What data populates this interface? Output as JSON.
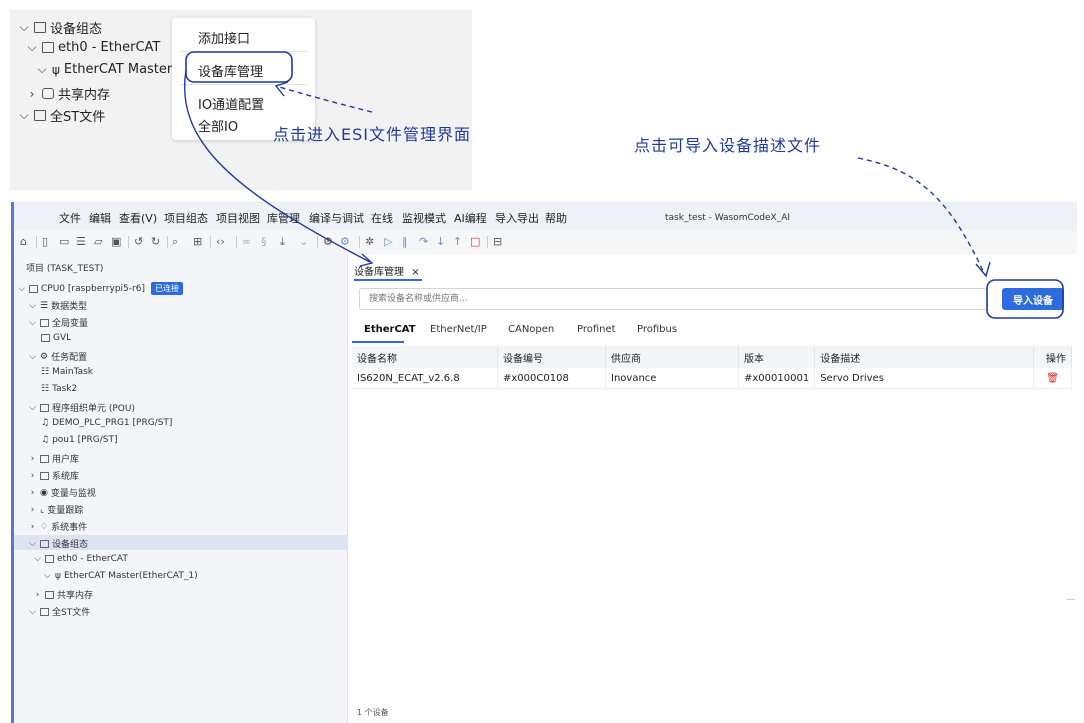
{
  "zoom": {
    "tree": [
      "设备组态",
      "eth0 - EtherCAT",
      "EtherCAT Master(",
      "共享内存",
      "全ST文件"
    ],
    "menu": [
      "添加接口",
      "设备库管理",
      "IO通道配置",
      "全部IO"
    ]
  },
  "annotations": {
    "esi": "点击进入ESI文件管理界面",
    "import": "点击可导入设备描述文件"
  },
  "window": {
    "title": "task_test - WasomCodeX_AI",
    "menus": [
      "文件",
      "编辑",
      "查看(V)",
      "项目组态",
      "项目视图",
      "库管理",
      "编译与调试",
      "在线",
      "监视模式",
      "AI编程",
      "导入导出",
      "帮助"
    ],
    "toolbar_icons": [
      "home-icon",
      "new-icon",
      "save-icon",
      "list-icon",
      "folder-icon",
      "disk-icon",
      "undo-icon",
      "redo-icon",
      "search-icon",
      "structure-icon",
      "code-icon",
      "link-icon",
      "unlink-icon",
      "download-icon",
      "dropdown-icon",
      "gear-icon",
      "settings-icon",
      "debug-icon",
      "run-icon",
      "pause-icon",
      "step-over-icon",
      "step-into-icon",
      "step-out-icon",
      "stop-icon",
      "package-icon"
    ]
  },
  "project": {
    "header": "项目 (TASK_TEST)",
    "cpu": "CPU0 [raspberrypi5-r6]",
    "status": "已连接",
    "items": [
      "数据类型",
      "全局变量",
      "GVL",
      "任务配置",
      "MainTask",
      "Task2",
      "程序组织单元 (POU)",
      "DEMO_PLC_PRG1 [PRG/ST]",
      "pou1 [PRG/ST]",
      "用户库",
      "系统库",
      "变量与监视",
      "变量跟踪",
      "系统事件",
      "设备组态",
      "eth0 - EtherCAT",
      "EtherCAT Master(EtherCAT_1)",
      "共享内存",
      "全ST文件"
    ]
  },
  "devlib": {
    "tab": "设备库管理",
    "close": "×",
    "search_placeholder": "搜索设备名称或供应商...",
    "import_label": "导入设备",
    "protocol_tabs": [
      "EtherCAT",
      "EtherNet/IP",
      "CANopen",
      "Profinet",
      "Profibus"
    ],
    "columns": [
      "设备名称",
      "设备编号",
      "供应商",
      "版本",
      "设备描述",
      "操作"
    ],
    "rows": [
      {
        "name": "IS620N_ECAT_v2.6.8",
        "id": "#x000C0108",
        "vendor": "Inovance",
        "version": "#x00010001",
        "desc": "Servo Drives",
        "action": "delete-icon"
      }
    ],
    "footer": "1 个设备"
  },
  "colors": {
    "accent": "#2c6be0",
    "annotation": "#1f3aa0",
    "delete": "#e03030"
  }
}
